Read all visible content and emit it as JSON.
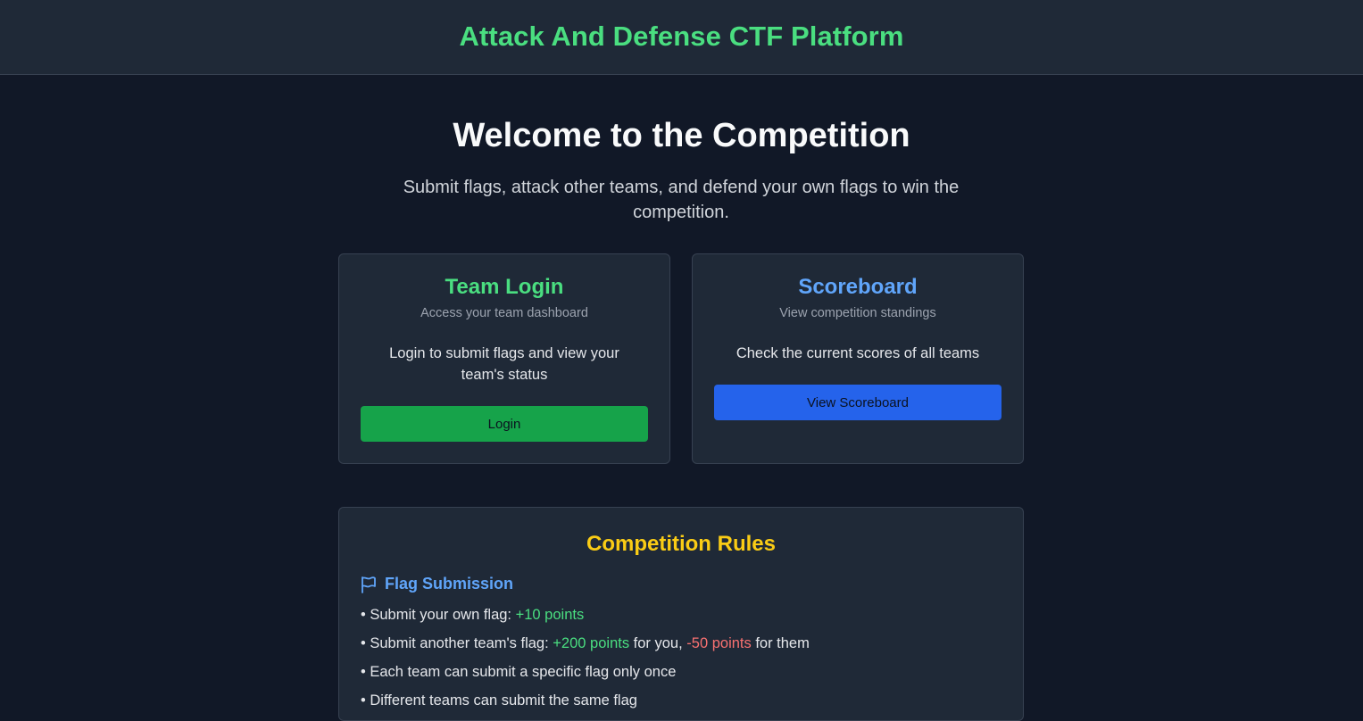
{
  "header": {
    "title": "Attack And Defense CTF Platform"
  },
  "hero": {
    "title": "Welcome to the Competition",
    "subtitle": "Submit flags, attack other teams, and defend your own flags to win the competition."
  },
  "cards": {
    "login": {
      "title": "Team Login",
      "description": "Access your team dashboard",
      "body": "Login to submit flags and view your team's status",
      "button": "Login"
    },
    "scoreboard": {
      "title": "Scoreboard",
      "description": "View competition standings",
      "body": "Check the current scores of all teams",
      "button": "View Scoreboard"
    }
  },
  "rules": {
    "title": "Competition Rules",
    "section_icon": "flag-icon",
    "section_title": "Flag Submission",
    "items": {
      "own_flag": {
        "prefix": "• Submit your own flag: ",
        "points": "+10 points"
      },
      "other_flag": {
        "prefix": "• Submit another team's flag: ",
        "points_you": "+200 points",
        "middle": " for you, ",
        "points_them": "-50 points",
        "suffix": " for them"
      },
      "once": "• Each team can submit a specific flag only once",
      "same_flag": "• Different teams can submit the same flag"
    }
  },
  "colors": {
    "background": "#111827",
    "panel": "#1f2937",
    "green": "#4ade80",
    "blue": "#60a5fa",
    "yellow": "#facc15",
    "red": "#f87171",
    "login_button": "#16a34a",
    "scoreboard_button": "#2563eb"
  }
}
